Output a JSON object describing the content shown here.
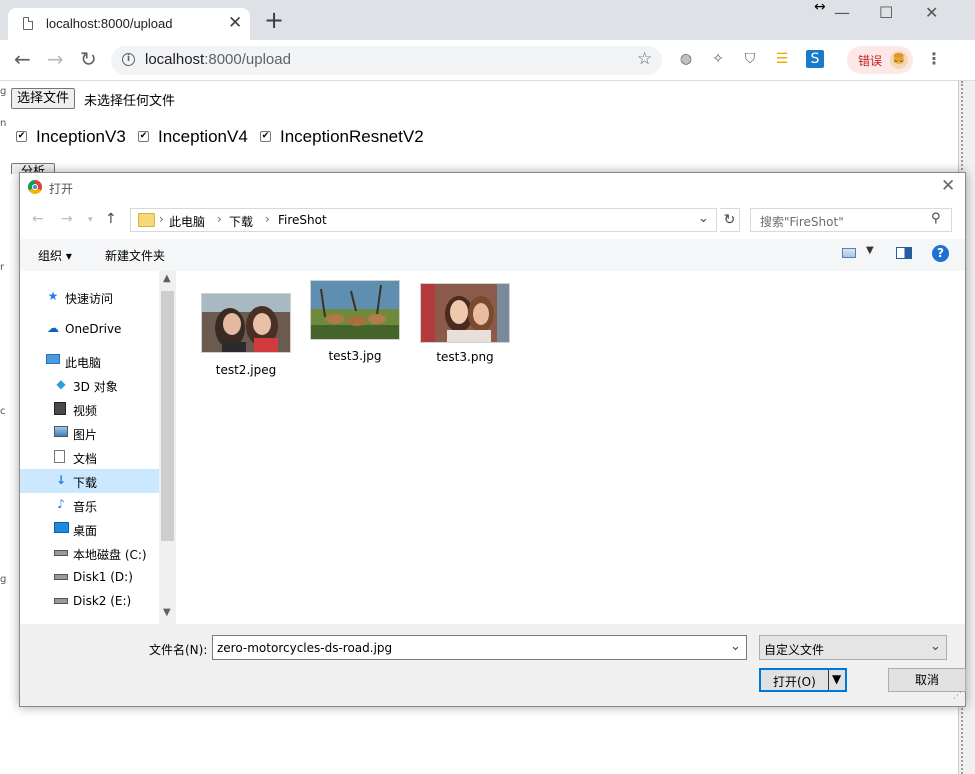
{
  "browser": {
    "tab_title": "localhost:8000/upload",
    "tab_close": "✕",
    "new_tab": "+",
    "url_host": "localhost",
    "url_rest": ":8000/upload",
    "error_label": "错误",
    "window_buttons": [
      "—",
      "☐",
      "✕"
    ],
    "nav": {
      "back": "←",
      "forward": "→",
      "reload": "↻"
    }
  },
  "page": {
    "choose_file_label": "选择文件",
    "no_file_text": "未选择任何文件",
    "checkboxes": [
      {
        "label": "InceptionV3",
        "checked": true
      },
      {
        "label": "InceptionV4",
        "checked": true
      },
      {
        "label": "InceptionResnetV2",
        "checked": true
      }
    ],
    "analyze_label": "分析"
  },
  "dialog": {
    "title": "打开",
    "breadcrumb": [
      "此电脑",
      "下载",
      "FireShot"
    ],
    "search_placeholder": "搜索\"FireShot\"",
    "toolbar": {
      "organize": "组织 ▾",
      "new_folder": "新建文件夹"
    },
    "nav_items": [
      {
        "label": "快速访问",
        "icon": "star-icon",
        "selected": false
      },
      {
        "label": "OneDrive",
        "icon": "cloud-icon",
        "selected": false
      },
      {
        "label": "此电脑",
        "icon": "computer-icon",
        "selected": false
      },
      {
        "label": "3D 对象",
        "icon": "cube-icon",
        "selected": false
      },
      {
        "label": "视频",
        "icon": "video-icon",
        "selected": false
      },
      {
        "label": "图片",
        "icon": "picture-icon",
        "selected": false
      },
      {
        "label": "文档",
        "icon": "document-icon",
        "selected": false
      },
      {
        "label": "下载",
        "icon": "download-icon",
        "selected": true
      },
      {
        "label": "音乐",
        "icon": "music-icon",
        "selected": false
      },
      {
        "label": "桌面",
        "icon": "desktop-icon",
        "selected": false
      },
      {
        "label": "本地磁盘 (C:)",
        "icon": "drive-icon",
        "selected": false
      },
      {
        "label": "Disk1 (D:)",
        "icon": "drive-icon",
        "selected": false
      },
      {
        "label": "Disk2 (E:)",
        "icon": "drive-icon",
        "selected": false
      }
    ],
    "files": [
      {
        "name": "test2.jpeg"
      },
      {
        "name": "test3.jpg"
      },
      {
        "name": "test3.png"
      }
    ],
    "filename_label": "文件名(N):",
    "filename_value": "zero-motorcycles-ds-road.jpg",
    "filetype_value": "自定义文件",
    "open_label": "打开(O)",
    "cancel_label": "取消"
  }
}
